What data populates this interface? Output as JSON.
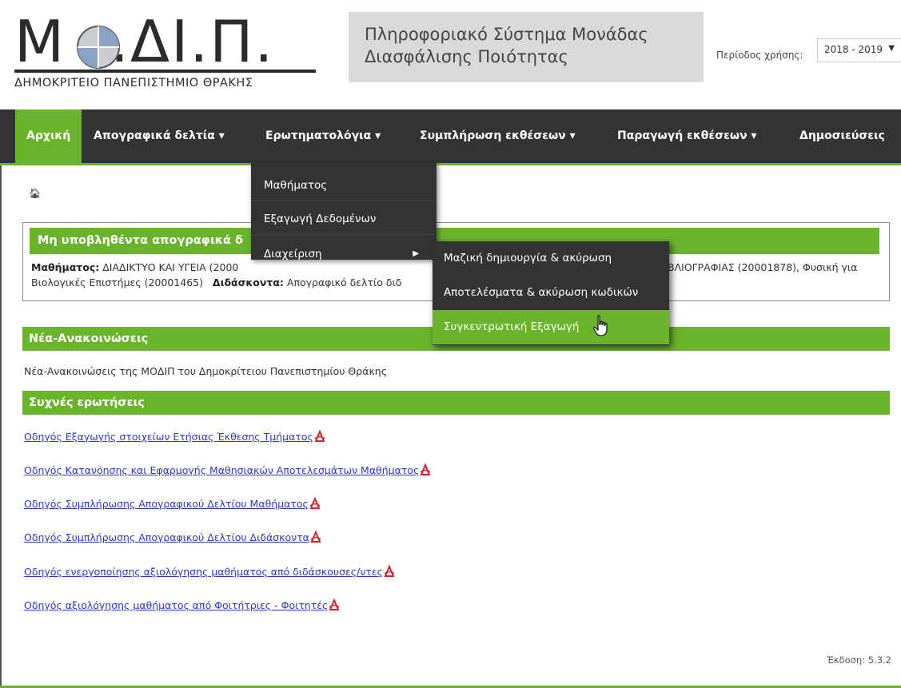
{
  "header": {
    "logo_main": "Μ",
    "logo_rest": ".ΔΙ.Π.",
    "logo_subtitle": "ΔΗΜΟΚΡΙΤΕΙΟ ΠΑΝΕΠΙΣΤΗΜΙΟ ΘΡΑΚΗΣ",
    "system_title_line1": "Πληροφοριακό Σύστημα Μονάδας",
    "system_title_line2": "Διασφάλισης Ποιότητας",
    "period_label": "Περίοδος χρήσης:",
    "period_value": "2018 - 2019"
  },
  "nav": {
    "items": [
      {
        "label": "Αρχική"
      },
      {
        "label": "Απογραφικά δελτία ▾"
      },
      {
        "label": "Ερωτηματολόγια ▾"
      },
      {
        "label": "Συμπλήρωση εκθέσεων ▾"
      },
      {
        "label": "Παραγωγή εκθέσεων ▾"
      },
      {
        "label": "Δημοσιεύσεις"
      }
    ]
  },
  "dropdown": {
    "items": [
      {
        "label": "Μαθήματος"
      },
      {
        "label": "Εξαγωγή Δεδομένων"
      },
      {
        "label": "Διαχείριση"
      }
    ],
    "submenu": [
      {
        "label": "Μαζική δημιουργία & ακύρωση"
      },
      {
        "label": "Αποτελέσματα & ακύρωση κωδικών"
      },
      {
        "label": "Συγκεντρωτική Εξαγωγή"
      }
    ]
  },
  "unsubmitted": {
    "title": "Μη υποβληθέντα απογραφικά δ",
    "courses_label": "Μαθήματος:",
    "courses_text_a": " ΔΙΑΔΙΚΤΥΟ ΚΑΙ ΥΓΕΙΑ (2000",
    "courses_text_b": "ΒΛΙΟΓΡΑΦΙΑΣ (20001878), Φυσική για",
    "courses_text_c": "Βιολογικές Επιστήμες (20001465)",
    "teachers_label": "Διδάσκοντα:",
    "teachers_text": " Απογραφικό δελτίο διδ"
  },
  "announcements": {
    "title": "Νέα-Ανακοινώσεις",
    "text": "Νέα-Ανακοινώσεις της ΜΟΔΙΠ του Δημοκρίτειου Πανεπιστημίου Θράκης"
  },
  "faq": {
    "title": "Συχνές ερωτήσεις",
    "links": [
      {
        "label": "Οδηγός Εξαγωγής στοιχείων Ετήσιας Έκθεσης Τμήματος"
      },
      {
        "label": "Οδηγός Κατανόησης και Εφαρμογής Μαθησιακών Αποτελεσμάτων Μαθήματος"
      },
      {
        "label": "Οδηγός Συμπλήρωσης Απογραφικού Δελτίου Μαθήματος"
      },
      {
        "label": "Οδηγός Συμπλήρωσης Απογραφικού Δελτίου Διδάσκοντα"
      },
      {
        "label": "Οδηγός ενεργοποίησης αξιολόγησης μαθήματος από διδάσκουσες/ντες"
      },
      {
        "label": "Οδηγός αξιολόγησης μαθήματος από Φοιτήτριες - Φοιτητές"
      }
    ]
  },
  "footer": {
    "version": "Έκδοση: 5.3.2"
  },
  "colors": {
    "accent": "#6ab42d",
    "nav_bg": "#333333",
    "link": "#2a3ac8"
  }
}
